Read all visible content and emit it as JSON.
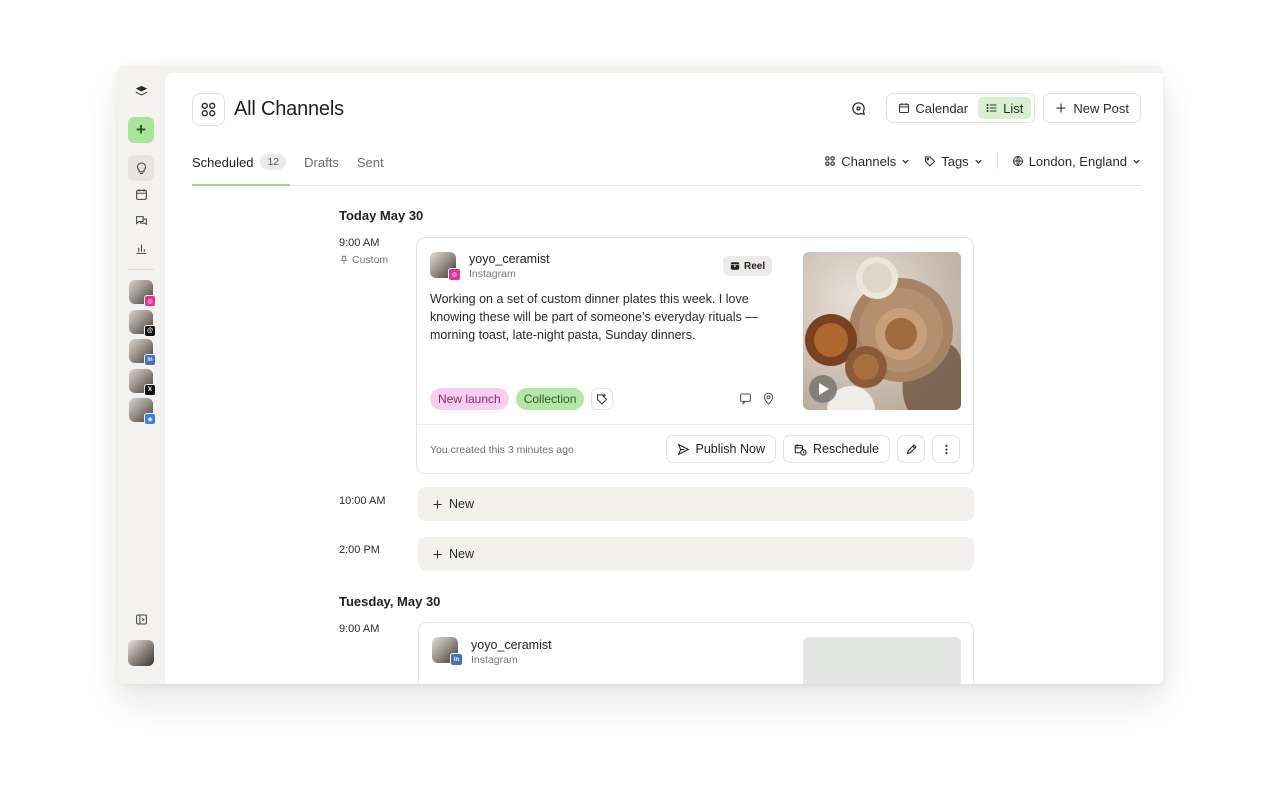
{
  "sidebar": {
    "icons": [
      "layers-icon",
      "plus-icon",
      "lightbulb-icon",
      "calendar-icon",
      "chat-icon",
      "bar-chart-icon"
    ],
    "channels": [
      {
        "network": "Instagram",
        "badge_color": "#e9338f"
      },
      {
        "network": "Threads",
        "badge_color": "#111111"
      },
      {
        "network": "LinkedIn",
        "badge_color": "#3e73c4"
      },
      {
        "network": "X",
        "badge_color": "#111111"
      },
      {
        "network": "Bluesky",
        "badge_color": "#2f83ea"
      }
    ]
  },
  "header": {
    "title": "All Channels",
    "view_calendar": "Calendar",
    "view_list": "List",
    "new_post": "New Post"
  },
  "tabs": {
    "scheduled": "Scheduled",
    "scheduled_count": "12",
    "drafts": "Drafts",
    "sent": "Sent"
  },
  "filters": {
    "channels": "Channels",
    "tags": "Tags",
    "location": "London, England"
  },
  "schedule": {
    "day1": {
      "heading": "Today May 30",
      "post": {
        "time": "9:00 AM",
        "time_sub": "Custom",
        "user": "yoyo_ceramist",
        "network": "Instagram",
        "format": "Reel",
        "text": "Working on a set of custom dinner plates this week. I love knowing these will be part of someone’s everyday rituals — morning toast, late-night pasta, Sunday dinners.",
        "tags": [
          "New launch",
          "Collection"
        ],
        "created": "You created this 3 minutes ago",
        "publish": "Publish Now",
        "reschedule": "Reschedule"
      },
      "slots": [
        {
          "time": "10:00 AM",
          "label": "New"
        },
        {
          "time": "2:00 PM",
          "label": "New"
        }
      ]
    },
    "day2": {
      "heading": "Tuesday, May 30",
      "post": {
        "time": "9:00 AM",
        "user": "yoyo_ceramist",
        "network": "Instagram"
      }
    }
  },
  "colors": {
    "accent_green": "#a7e59b",
    "list_active": "#d7f0cf",
    "tag_launch": "#f8cff0",
    "tag_collection": "#b4e6a7"
  }
}
